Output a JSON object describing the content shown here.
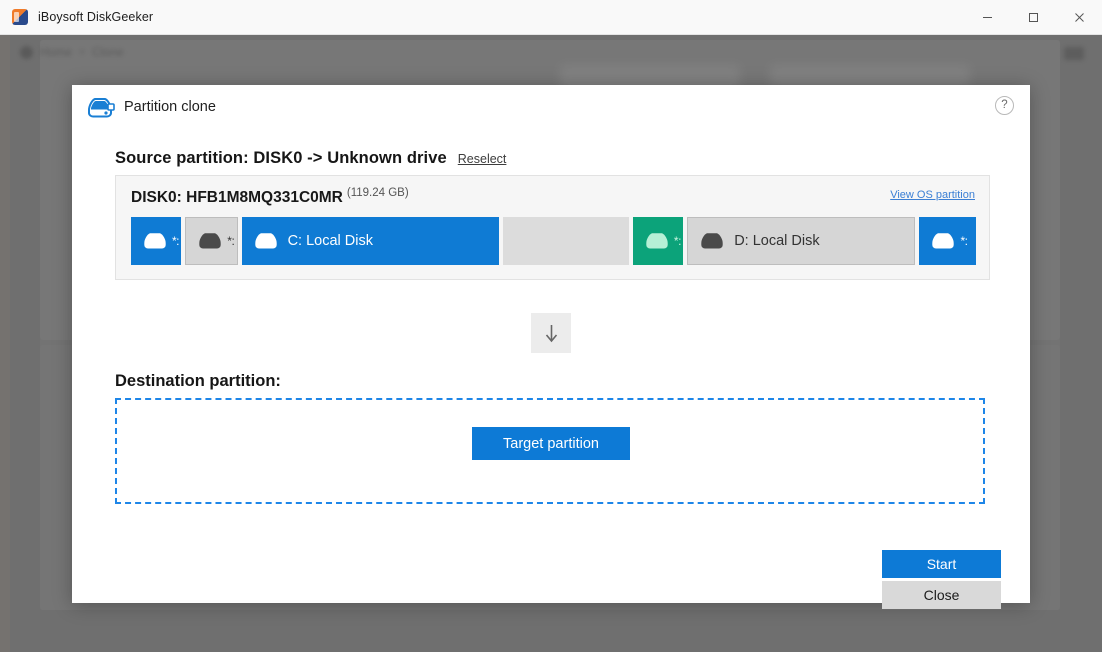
{
  "window": {
    "title": "iBoysoft DiskGeeker",
    "app_icon": "app-logo-icon",
    "controls": {
      "minimize": "minimize-icon",
      "maximize": "maximize-icon",
      "close": "close-icon"
    }
  },
  "background": {
    "breadcrumb": {
      "home": "Home",
      "separator": "»",
      "current": "Clone"
    },
    "menu_icon": "menu-icon"
  },
  "dialog": {
    "icon": "partition-clone-icon",
    "title": "Partition clone",
    "help_label": "?",
    "source": {
      "heading": "Source partition: DISK0 -> Unknown drive",
      "reselect_label": "Reselect",
      "disk_name": "DISK0: HFB1M8MQ331C0MR",
      "disk_size": "(119.24 GB)",
      "view_os_partition_label": "View OS partition",
      "partitions": [
        {
          "label": "*:",
          "type": "blue",
          "icon": "disk-icon",
          "flex": 8,
          "has_icon": true,
          "starred": true
        },
        {
          "label": "*:",
          "type": "gray",
          "icon": "disk-icon",
          "flex": 8,
          "has_icon": true,
          "starred": true
        },
        {
          "label": "C: Local Disk",
          "type": "blue",
          "icon": "disk-icon",
          "flex": 41,
          "has_icon": true,
          "starred": false
        },
        {
          "label": "",
          "type": "empty",
          "icon": "",
          "flex": 20,
          "has_icon": false,
          "starred": false
        },
        {
          "label": "*:",
          "type": "green",
          "icon": "disk-icon",
          "flex": 8,
          "has_icon": true,
          "starred": true
        },
        {
          "label": "D: Local Disk",
          "type": "gray",
          "icon": "disk-icon",
          "flex": 36,
          "has_icon": true,
          "starred": false
        },
        {
          "label": "*:",
          "type": "blue",
          "icon": "disk-icon",
          "flex": 9,
          "has_icon": true,
          "starred": true
        }
      ]
    },
    "arrow_icon": "arrow-down-icon",
    "destination": {
      "heading": "Destination partition:",
      "target_button_label": "Target partition"
    },
    "footer": {
      "start_label": "Start",
      "close_label": "Close"
    }
  },
  "colors": {
    "accent_blue": "#0d7ad6",
    "partition_blue": "#0f7bd4",
    "partition_green": "#0ca37a",
    "partition_gray": "#d6d6d6",
    "link_blue": "#3b7fd4",
    "overlay_gray": "#6f6f6f"
  }
}
